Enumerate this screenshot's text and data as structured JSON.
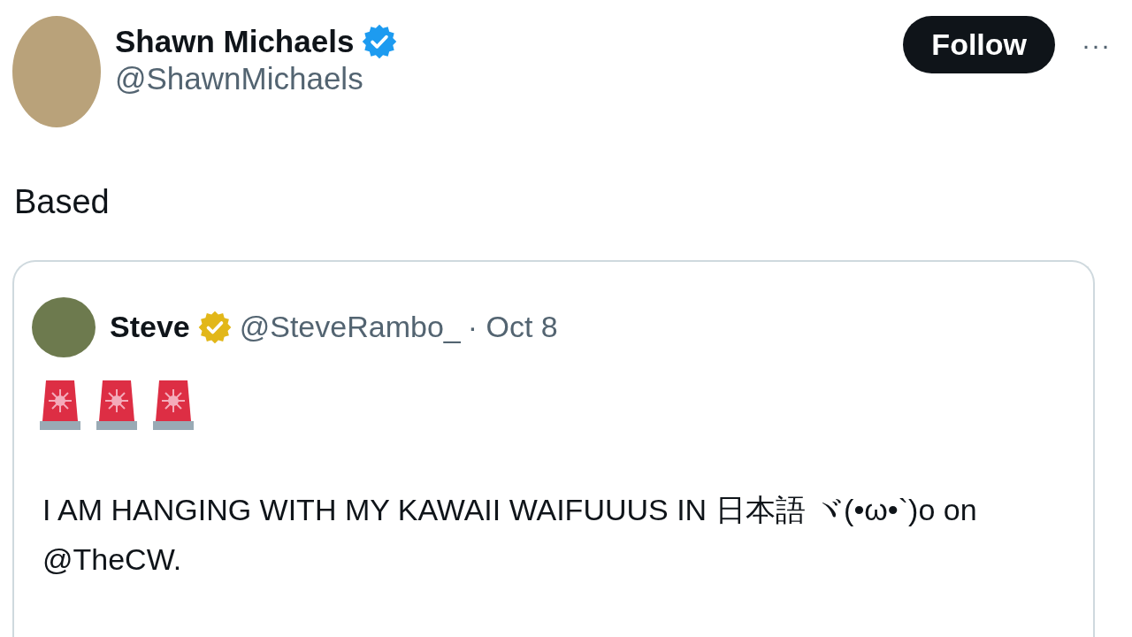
{
  "author": {
    "name": "Shawn Michaels",
    "verified": true,
    "handle": "@ShawnMichaels"
  },
  "follow_button": {
    "label": "Follow"
  },
  "more_button": {
    "label": "···"
  },
  "text": "Based",
  "quoted_tweet": {
    "name": "Steve",
    "verified": true,
    "handle": "@SteveRambo_",
    "date": "· Oct 8",
    "text": "I AM HANGING WITH MY KAWAII WAIFUUUS IN 日本語 ヾ(•ω•`)o on @TheCW."
  }
}
